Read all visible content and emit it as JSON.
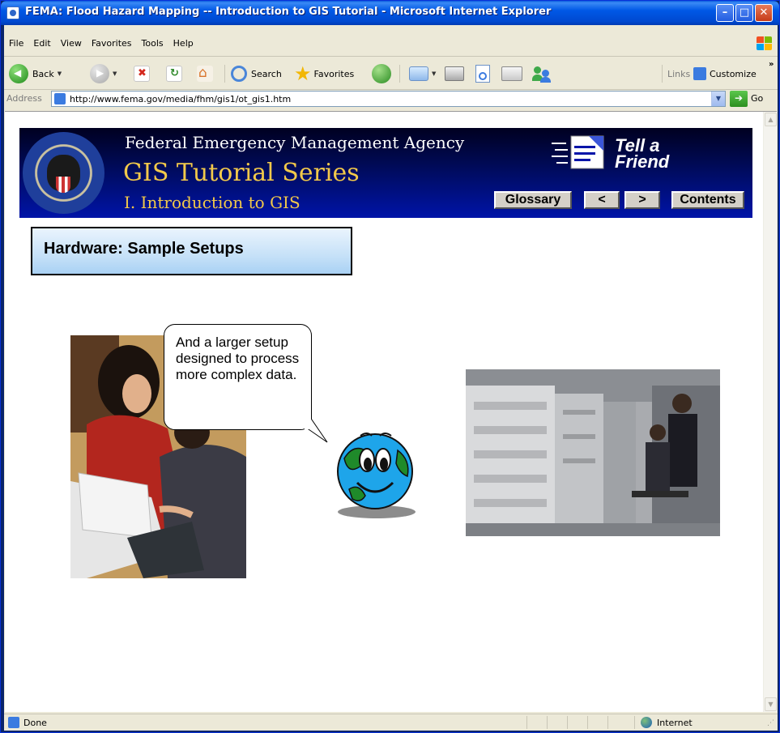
{
  "window": {
    "title": "FEMA: Flood Hazard Mapping -- Introduction to GIS Tutorial - Microsoft Internet Explorer"
  },
  "menu": [
    "File",
    "Edit",
    "View",
    "Favorites",
    "Tools",
    "Help"
  ],
  "toolbar": {
    "back_label": "Back",
    "search_label": "Search",
    "favorites_label": "Favorites",
    "links_label": "Links",
    "customize_label": "Customize",
    "overflow_glyph": "»"
  },
  "address": {
    "label": "Address",
    "url": "http://www.fema.gov/media/fhm/gis1/ot_gis1.htm",
    "go_label": "Go"
  },
  "banner": {
    "agency": "Federal Emergency Management Agency",
    "series": "GIS Tutorial Series",
    "module": "I. Introduction to GIS",
    "tell_a_friend": "Tell a\nFriend",
    "glossary_label": "Glossary",
    "prev_label": "<",
    "next_label": ">",
    "contents_label": "Contents"
  },
  "content": {
    "section_title": "Hardware: Sample Setups",
    "bubble_text": "And a larger setup designed to process more complex data."
  },
  "status": {
    "text": "Done",
    "zone": "Internet"
  },
  "colors": {
    "banner_gold": "#f2c94a",
    "banner_navy": "#000a55",
    "heading_blue": "#a9d1f4"
  }
}
